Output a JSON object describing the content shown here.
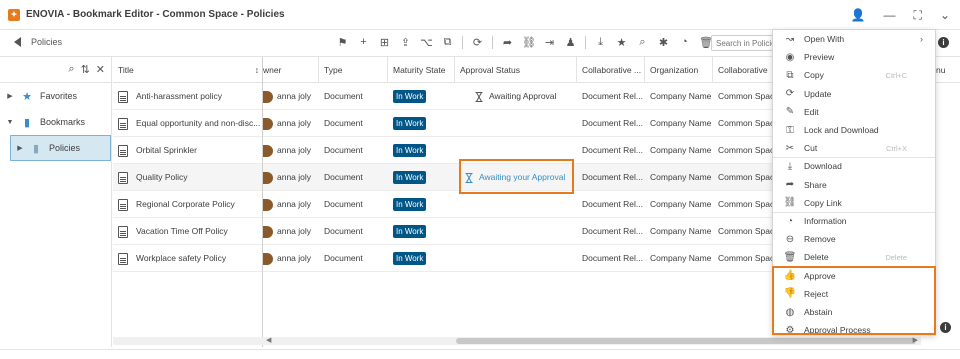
{
  "window": {
    "title": "ENOVIA - Bookmark Editor - Common Space - Policies"
  },
  "toolbar": {
    "back_label": "Policies",
    "search_placeholder": "Search in Policies"
  },
  "tree": {
    "items": [
      {
        "label": "Favorites",
        "icon": "star-icon"
      },
      {
        "label": "Bookmarks",
        "icon": "bookmark-icon"
      },
      {
        "label": "Policies",
        "icon": "bookmark-icon"
      }
    ]
  },
  "grid": {
    "headers": {
      "title": "Title",
      "owner": "wner",
      "type": "Type",
      "maturity": "Maturity State",
      "approval": "Approval Status",
      "collab_space": "Collaborative ...",
      "organization": "Organization",
      "collab": "Collaborative",
      "last": "nu"
    },
    "rows": [
      {
        "title": "Anti-harassment policy",
        "owner": "anna joly",
        "type": "Document",
        "maturity": "In Work",
        "approval": "Awaiting Approval",
        "collab_space": "Document Rel...",
        "organization": "Company Name",
        "collab": "Common Spac"
      },
      {
        "title": "Equal opportunity and non-disc...",
        "owner": "anna joly",
        "type": "Document",
        "maturity": "In Work",
        "approval": "",
        "collab_space": "Document Rel...",
        "organization": "Company Name",
        "collab": "Common Spac"
      },
      {
        "title": "Orbital Sprinkler",
        "owner": "anna joly",
        "type": "Document",
        "maturity": "In Work",
        "approval": "",
        "collab_space": "Document Rel...",
        "organization": "Company Name",
        "collab": "Common Spac"
      },
      {
        "title": "Quality Policy",
        "owner": "anna joly",
        "type": "Document",
        "maturity": "In Work",
        "approval": "Awaiting your Approval",
        "collab_space": "Document Rel...",
        "organization": "Company Name",
        "collab": "Common Spac"
      },
      {
        "title": "Regional Corporate Policy",
        "owner": "anna joly",
        "type": "Document",
        "maturity": "In Work",
        "approval": "",
        "collab_space": "Document Rel...",
        "organization": "Company Name",
        "collab": "Common Spac"
      },
      {
        "title": "Vacation Time Off Policy",
        "owner": "anna joly",
        "type": "Document",
        "maturity": "In Work",
        "approval": "",
        "collab_space": "Document Rel...",
        "organization": "Company Name",
        "collab": "Common Spac"
      },
      {
        "title": "Workplace safety Policy",
        "owner": "anna joly",
        "type": "Document",
        "maturity": "In Work",
        "approval": "",
        "collab_space": "Document Rel...",
        "organization": "Company Name",
        "collab": "Common Spac"
      }
    ]
  },
  "context_menu": {
    "items": [
      {
        "label": "Open With",
        "icon": "open-with-icon",
        "shortcut": "",
        "submenu": true
      },
      {
        "label": "Preview",
        "icon": "eye-icon",
        "shortcut": ""
      },
      {
        "label": "Copy",
        "icon": "copy-icon",
        "shortcut": "Ctrl+C"
      },
      {
        "label": "Update",
        "icon": "refresh-icon",
        "shortcut": ""
      },
      {
        "label": "Edit",
        "icon": "pencil-icon",
        "shortcut": ""
      },
      {
        "label": "Lock and Download",
        "icon": "lock-download-icon",
        "shortcut": ""
      },
      {
        "label": "Cut",
        "icon": "scissors-icon",
        "shortcut": "Ctrl+X"
      },
      {
        "label": "Download",
        "icon": "download-icon",
        "shortcut": ""
      },
      {
        "label": "Share",
        "icon": "share-icon",
        "shortcut": ""
      },
      {
        "label": "Copy Link",
        "icon": "link-icon",
        "shortcut": ""
      },
      {
        "label": "Information",
        "icon": "info-icon",
        "shortcut": ""
      },
      {
        "label": "Remove",
        "icon": "remove-icon",
        "shortcut": ""
      },
      {
        "label": "Delete",
        "icon": "trash-icon",
        "shortcut": "Delete"
      },
      {
        "label": "Approve",
        "icon": "thumbs-up-icon",
        "shortcut": ""
      },
      {
        "label": "Reject",
        "icon": "thumbs-down-icon",
        "shortcut": ""
      },
      {
        "label": "Abstain",
        "icon": "abstain-icon",
        "shortcut": ""
      },
      {
        "label": "Approval Process",
        "icon": "approval-process-icon",
        "shortcut": ""
      }
    ]
  },
  "colors": {
    "accent": "#e87a1e",
    "badge": "#005686",
    "link": "#368ec4",
    "approve": "#5cb85c",
    "reject": "#d9534f"
  }
}
